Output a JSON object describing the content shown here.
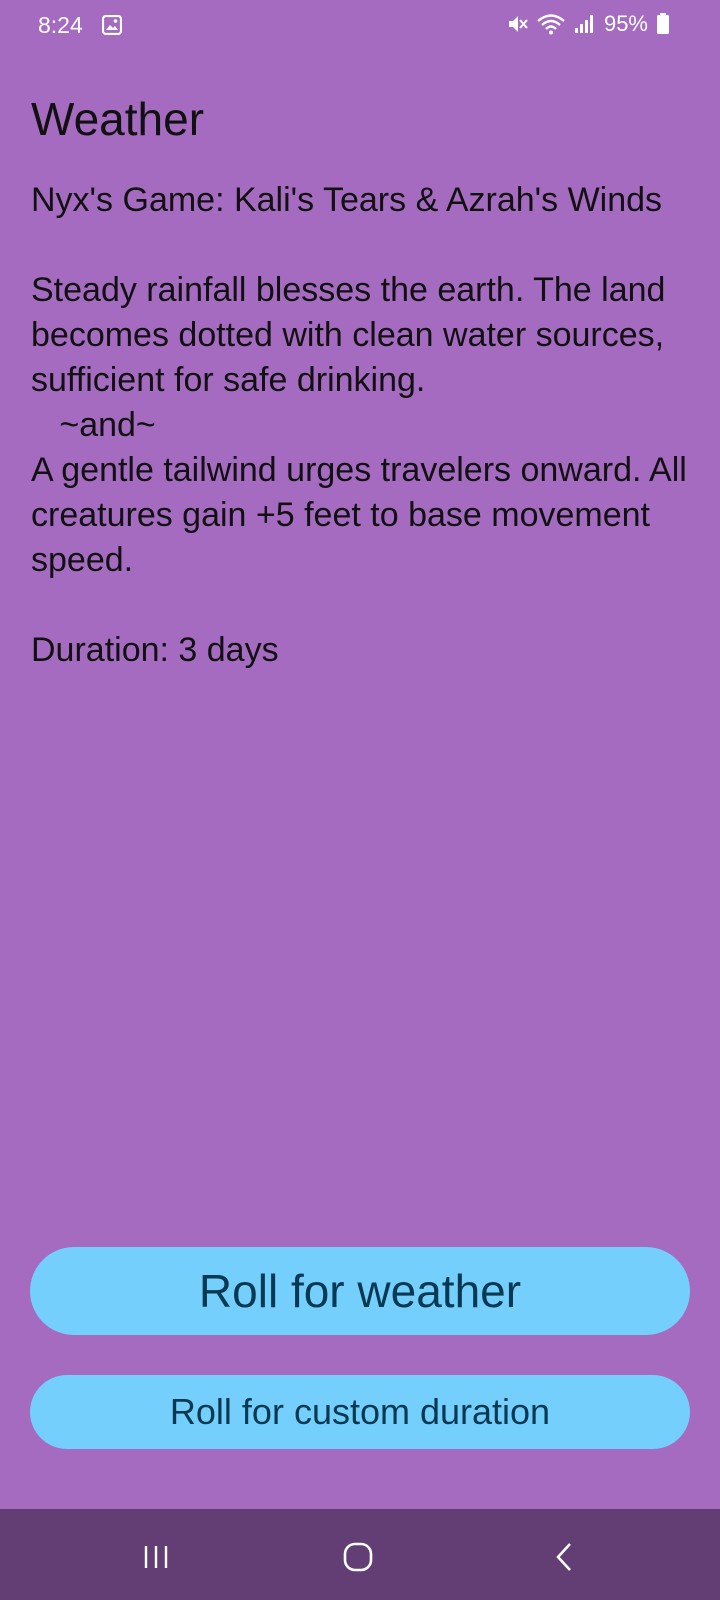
{
  "status_bar": {
    "time": "8:24",
    "battery_percent": "95%",
    "icons": [
      "gallery-icon",
      "mute-icon",
      "wifi-icon",
      "signal-icon",
      "battery-icon"
    ]
  },
  "page": {
    "title": "Weather",
    "content": "Nyx's Game: Kali's Tears & Azrah's Winds\n\nSteady rainfall blesses the earth. The land becomes dotted with clean water sources, sufficient for safe drinking.\n   ~and~\nA gentle tailwind urges travelers onward. All creatures gain +5 feet to base movement speed.\n\nDuration: 3 days"
  },
  "buttons": {
    "roll_weather": "Roll for weather",
    "roll_custom_duration": "Roll for custom duration"
  },
  "nav_bar": {
    "icons": [
      "recents-icon",
      "home-icon",
      "back-icon"
    ]
  },
  "colors": {
    "background": "#a56bc1",
    "button": "#74cffc",
    "button_text": "#073a52",
    "nav_bar": "#623e75"
  }
}
